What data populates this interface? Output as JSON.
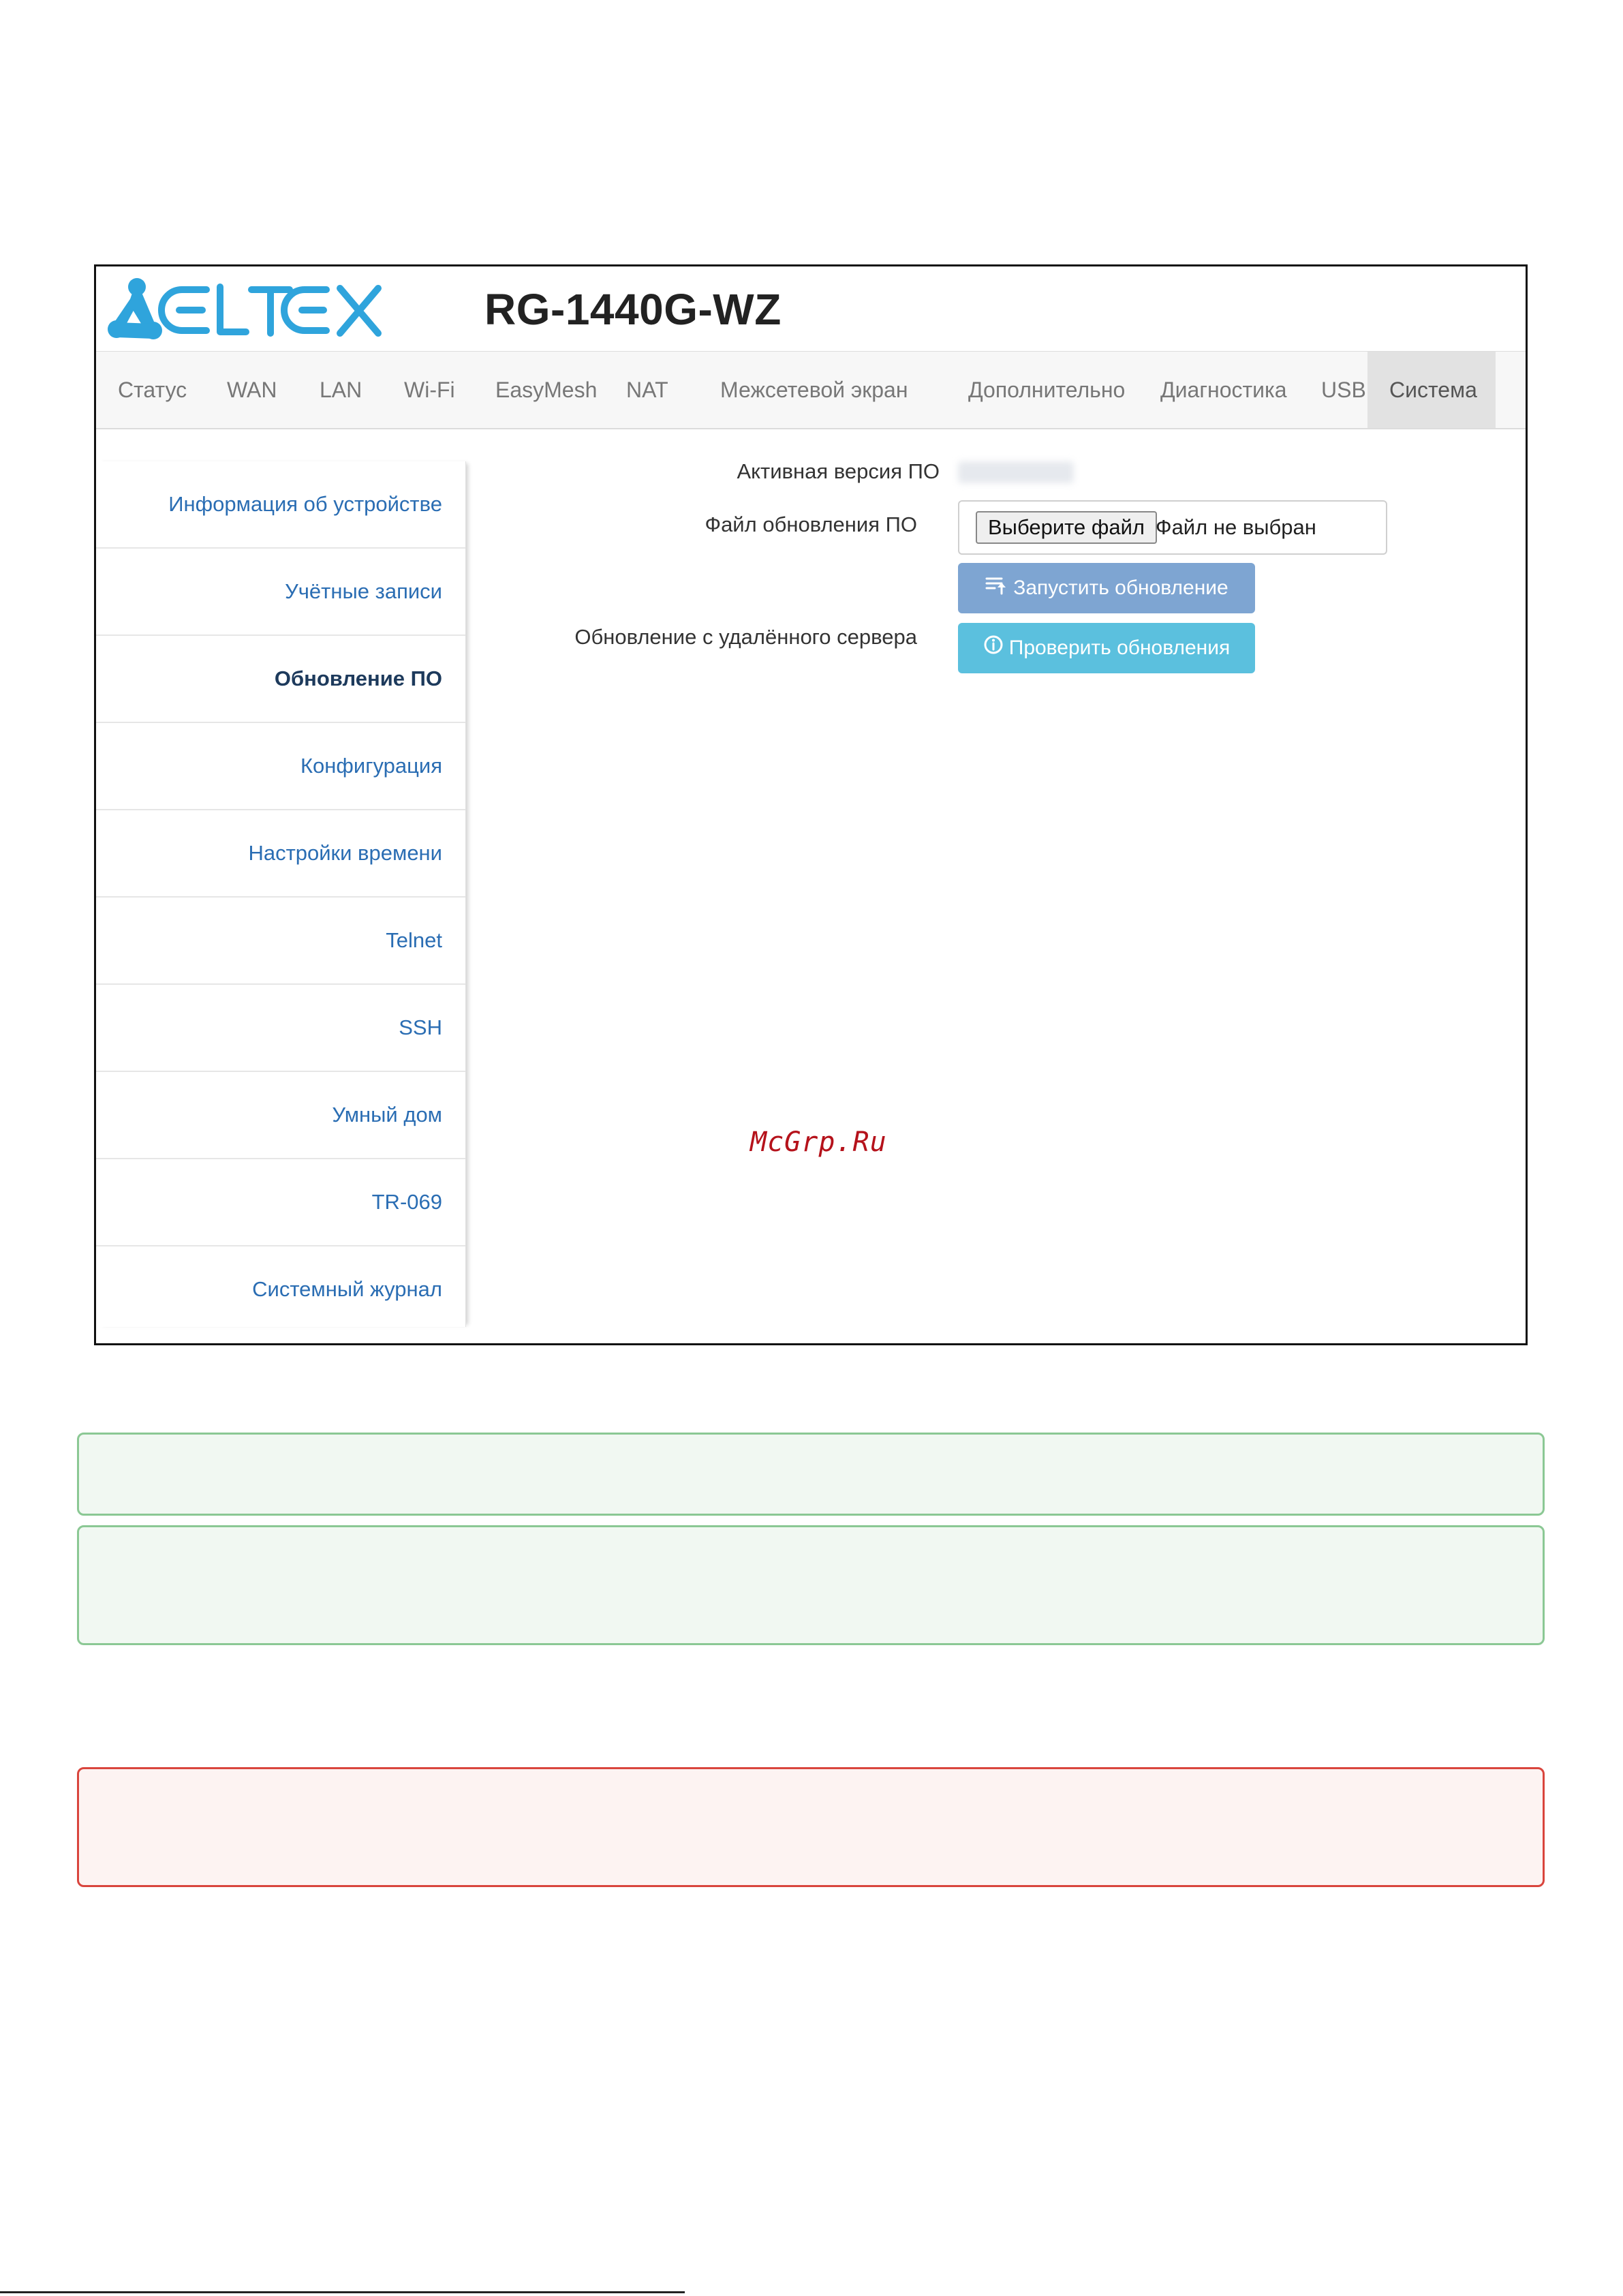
{
  "header": {
    "brand": "ELTEX",
    "device_model": "RG-1440G-WZ",
    "brand_color": "#2fa4dc"
  },
  "nav": {
    "items": [
      {
        "label": "Статус"
      },
      {
        "label": "WAN"
      },
      {
        "label": "LAN"
      },
      {
        "label": "Wi-Fi"
      },
      {
        "label": "EasyMesh"
      },
      {
        "label": "NAT"
      },
      {
        "label": "Межсетевой экран"
      },
      {
        "label": "Дополнительно"
      },
      {
        "label": "Диагностика"
      },
      {
        "label": "USB"
      },
      {
        "label": "Система",
        "active": true
      }
    ]
  },
  "sidebar": {
    "items": [
      {
        "label": "Информация об устройстве"
      },
      {
        "label": "Учётные записи"
      },
      {
        "label": "Обновление ПО",
        "active": true
      },
      {
        "label": "Конфигурация"
      },
      {
        "label": "Настройки времени"
      },
      {
        "label": "Telnet"
      },
      {
        "label": "SSH"
      },
      {
        "label": "Умный дом"
      },
      {
        "label": "TR-069"
      },
      {
        "label": "Системный журнал"
      }
    ]
  },
  "main": {
    "active_version_label": "Активная версия ПО",
    "update_file_label": "Файл обновления ПО",
    "choose_file_button": "Выберите файл",
    "file_status": "Файл не выбран",
    "run_update_button": "Запустить обновление",
    "remote_update_label": "Обновление с удалённого сервера",
    "check_updates_button": "Проверить обновления"
  },
  "watermark": "McGrp.Ru"
}
